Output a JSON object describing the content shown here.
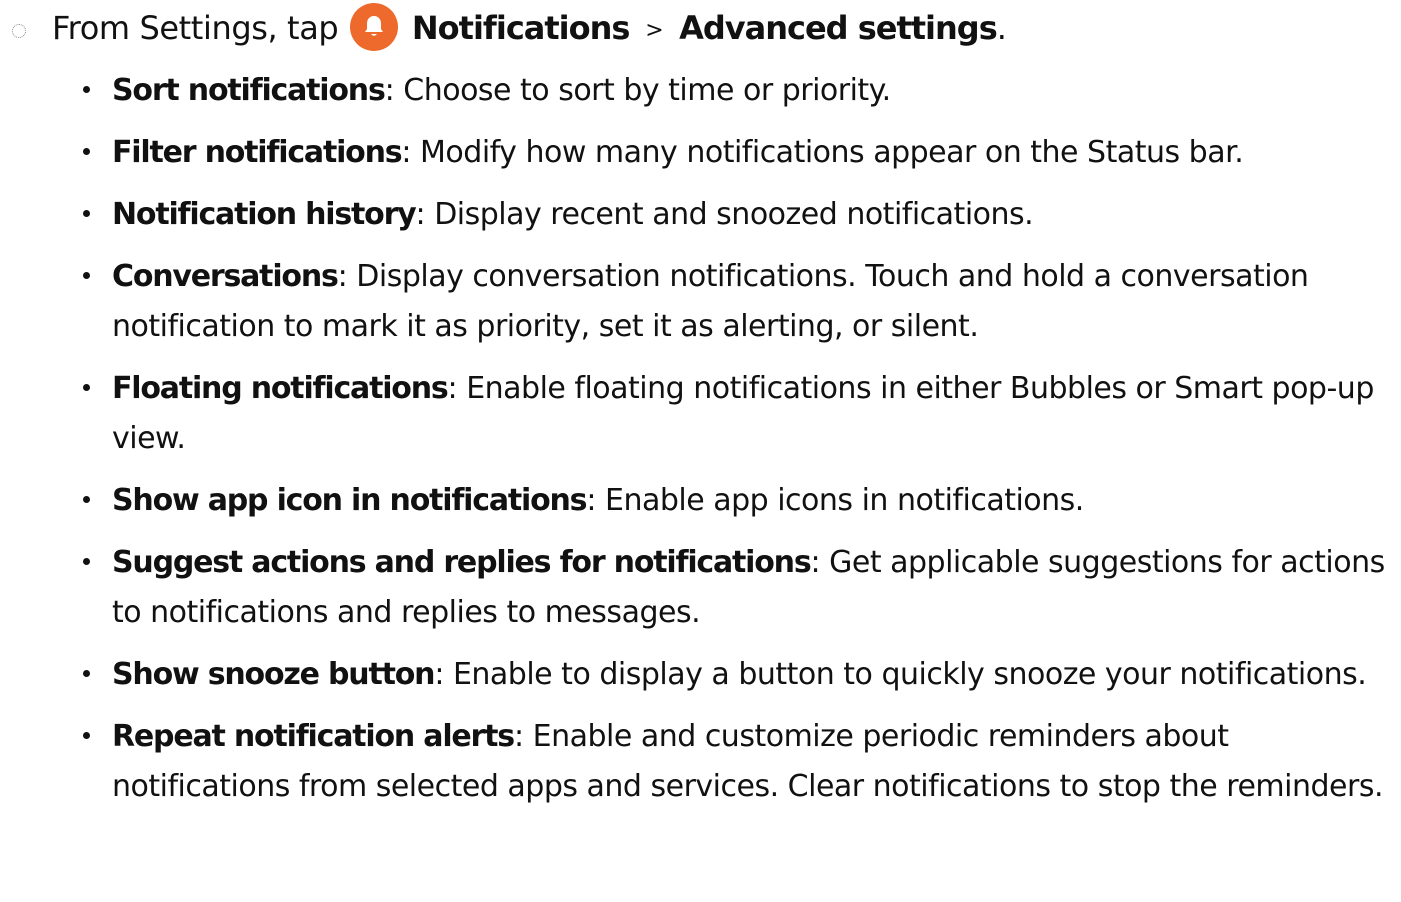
{
  "step": {
    "prefix": "From Settings, tap",
    "app_icon": "bell-icon",
    "app_icon_color": "#ee6a2c",
    "menu_1": "Notifications",
    "separator": ">",
    "menu_2": "Advanced settings",
    "end": "."
  },
  "options": [
    {
      "term": "Sort notifications",
      "description": ": Choose to sort by time or priority."
    },
    {
      "term": "Filter notifications",
      "description": ": Modify how many notifications appear on the Status bar."
    },
    {
      "term": "Notification history",
      "description": ": Display recent and snoozed notifications."
    },
    {
      "term": "Conversations",
      "description": ": Display conversation notifications. Touch and hold a conversation notification to mark it as priority, set it as alerting, or silent."
    },
    {
      "term": "Floating notifications",
      "description": ": Enable floating notifications in either Bubbles or Smart pop-up view."
    },
    {
      "term": "Show app icon in notifications",
      "description": ": Enable app icons in notifications."
    },
    {
      "term": "Suggest actions and replies for notifications",
      "description": ": Get applicable suggestions for actions to notifications and replies to messages."
    },
    {
      "term": "Show snooze button",
      "description": ": Enable to display a button to quickly snooze your notifications."
    },
    {
      "term": "Repeat notification alerts",
      "description": ": Enable and customize periodic reminders about notifications from selected apps and services. Clear notifications to stop the reminders."
    }
  ]
}
